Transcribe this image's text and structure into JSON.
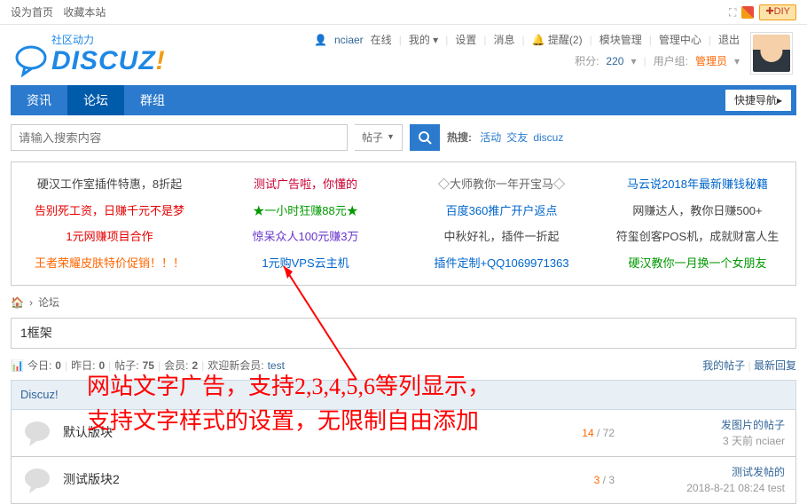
{
  "topbar": {
    "set_home": "设为首页",
    "fav": "收藏本站",
    "diy": "DIY"
  },
  "logo": {
    "tagline": "社区动力",
    "text": "DISCUZ"
  },
  "user": {
    "name": "nciaer",
    "status": "在线",
    "my": "我的",
    "down": "▾",
    "settings": "设置",
    "msg": "消息",
    "remind": "提醒(2)",
    "modmgr": "模块管理",
    "admincp": "管理中心",
    "logout": "退出",
    "credits_label": "积分:",
    "credits": "220",
    "group_label": "用户组:",
    "group": "管理员"
  },
  "nav": {
    "items": [
      "资讯",
      "论坛",
      "群组"
    ],
    "quicknav": "快捷导航"
  },
  "search": {
    "placeholder": "请输入搜索内容",
    "type": "帖子",
    "hot_label": "热搜:",
    "hot": [
      "活动",
      "交友",
      "discuz"
    ]
  },
  "ads": {
    "rows": [
      [
        {
          "text": "硬汉工作室插件特惠，8折起",
          "cls": ""
        },
        {
          "text": "测试广告啦，你懂的",
          "cls": "darkred"
        },
        {
          "text": "◇大师教你一年开宝马◇",
          "cls": "gray6"
        },
        {
          "text": "马云说2018年最新赚钱秘籍",
          "cls": "blue"
        }
      ],
      [
        {
          "text": "告别死工资，日赚千元不是梦",
          "cls": "red"
        },
        {
          "text": "★一小时狂赚88元★",
          "cls": "green"
        },
        {
          "text": "百度360推广开户返点",
          "cls": "blue"
        },
        {
          "text": "网赚达人，教你日赚500+",
          "cls": ""
        }
      ],
      [
        {
          "text": "1元网赚项目合作",
          "cls": "red"
        },
        {
          "text": "惊呆众人100元赚3万",
          "cls": "purple"
        },
        {
          "text": "中秋好礼，插件一折起",
          "cls": ""
        },
        {
          "text": "符玺创客POS机，成就财富人生",
          "cls": ""
        }
      ],
      [
        {
          "text": "王者荣耀皮肤特价促销！！！",
          "cls": "orange"
        },
        {
          "text": "1元购VPS云主机",
          "cls": "blue"
        },
        {
          "text": "插件定制+QQ1069971363",
          "cls": "blue"
        },
        {
          "text": "硬汉教你一月换一个女朋友",
          "cls": "green"
        }
      ]
    ]
  },
  "breadcrumb": {
    "home": "论坛"
  },
  "frame": "1框架",
  "stats": {
    "today_lbl": "今日:",
    "today": "0",
    "yest_lbl": "昨日:",
    "yest": "0",
    "posts_lbl": "帖子:",
    "posts": "75",
    "members_lbl": "会员:",
    "members": "2",
    "welcome": "欢迎新会员:",
    "new_member": "test",
    "my_posts": "我的帖子",
    "latest": "最新回复"
  },
  "board_head": "Discuz!",
  "forums": [
    {
      "name": "默认版块",
      "threads": "14",
      "posts": "72",
      "last_title": "发图片的帖子",
      "last_meta": "3 天前 nciaer"
    },
    {
      "name": "测试版块2",
      "threads": "3",
      "posts": "3",
      "last_title": "测试发帖的",
      "last_meta": "2018-8-21 08:24 test"
    }
  ],
  "annotation": {
    "line1": "网站文字广告，支持2,3,4,5,6等列显示，",
    "line2": "支持文字样式的设置，无限制自由添加"
  }
}
